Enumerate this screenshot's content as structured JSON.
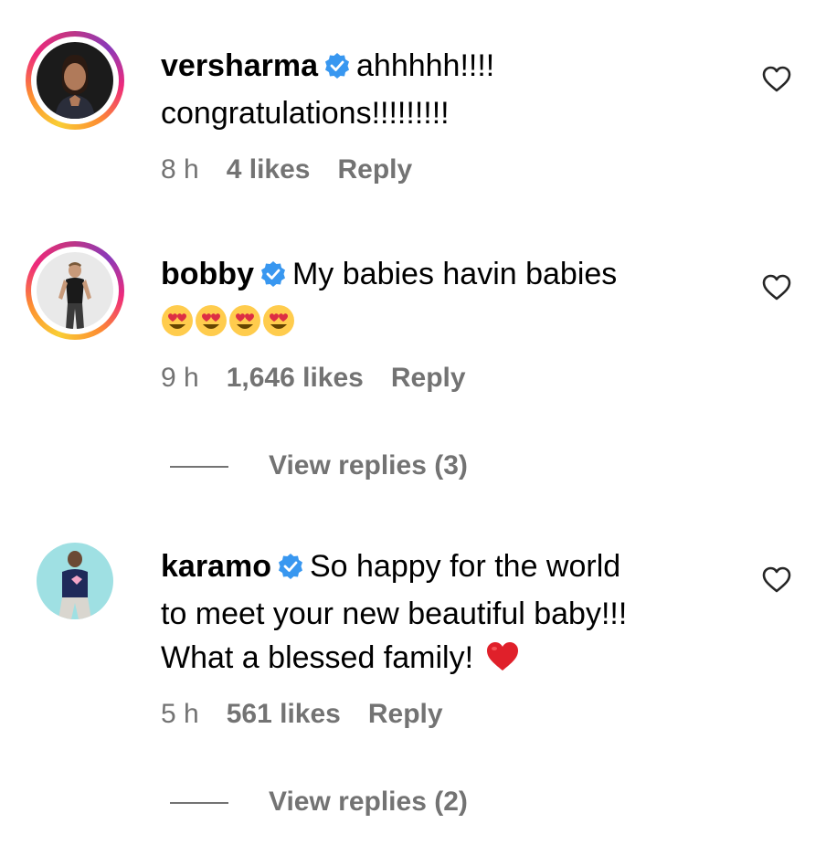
{
  "comments": [
    {
      "username": "versharma",
      "verified": true,
      "text_line1": "ahhhhh!!!!",
      "text_line2": "congratulations!!!!!!!!!",
      "time": "8 h",
      "likes": "4 likes",
      "reply_label": "Reply"
    },
    {
      "username": "bobby",
      "verified": true,
      "text_line1": "My babies havin babies",
      "emoji": "😍😍😍😍",
      "time": "9 h",
      "likes": "1,646 likes",
      "reply_label": "Reply",
      "view_replies": "View replies (3)"
    },
    {
      "username": "karamo",
      "verified": true,
      "text_line1": "So happy for the world",
      "text_line2": "to meet your new beautiful baby!!!",
      "text_line3": "What a blessed family!",
      "trailing_emoji": "❤️",
      "time": "5 h",
      "likes": "561 likes",
      "reply_label": "Reply",
      "view_replies": "View replies (2)"
    }
  ],
  "icons": {
    "verified": "verified-badge-icon",
    "like": "heart-outline-icon"
  },
  "colors": {
    "verified_blue": "#3897f0",
    "meta_gray": "#737373",
    "heart_red": "#e0202a"
  }
}
